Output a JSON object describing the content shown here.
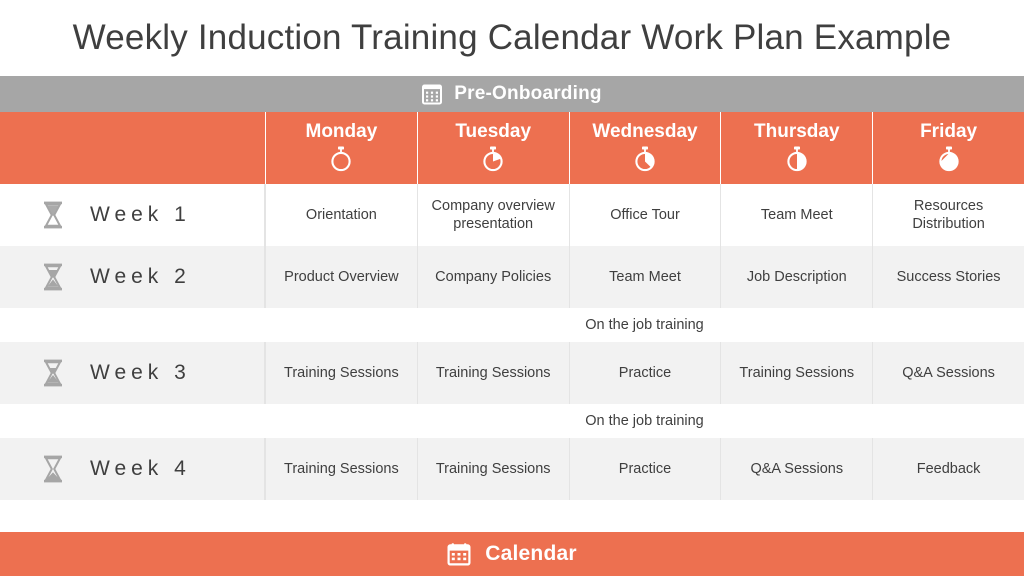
{
  "slide": {
    "title": "Weekly Induction Training Calendar Work Plan Example"
  },
  "banner": {
    "icon": "calendar-grid-icon",
    "label": "Pre-Onboarding",
    "background": "#A6A6A6",
    "text_color": "#FFFFFF"
  },
  "theme": {
    "accent": "#ED7050",
    "banner_gray": "#A6A6A6",
    "row_alt": "#F2F2F2",
    "row_plain": "#FFFFFF",
    "text": "#3F3F3F",
    "icon_gray": "#A6A6A6",
    "divider": "#E4E4E4"
  },
  "header": {
    "corner_label": "",
    "days": [
      {
        "label": "Monday",
        "icon": "stopwatch-icon",
        "fill": 0
      },
      {
        "label": "Tuesday",
        "icon": "stopwatch-icon",
        "fill": 25
      },
      {
        "label": "Wednesday",
        "icon": "stopwatch-icon",
        "fill": 35
      },
      {
        "label": "Thursday",
        "icon": "stopwatch-icon",
        "fill": 50
      },
      {
        "label": "Friday",
        "icon": "stopwatch-icon",
        "fill": 75
      }
    ]
  },
  "rows": [
    {
      "type": "week",
      "icon": "hourglass-icon",
      "label": "Week 1",
      "shade": "plain",
      "cells": [
        "Orientation",
        "Company overview presentation",
        "Office Tour",
        "Team Meet",
        "Resources Distribution"
      ]
    },
    {
      "type": "week",
      "icon": "hourglass-icon",
      "label": "Week 2",
      "shade": "alt",
      "cells": [
        "Product Overview",
        "Company Policies",
        "Team Meet",
        "Job Description",
        "Success Stories"
      ]
    },
    {
      "type": "divider",
      "label": "On the job training"
    },
    {
      "type": "week",
      "icon": "hourglass-icon",
      "label": "Week 3",
      "shade": "alt",
      "cells": [
        "Training Sessions",
        "Training Sessions",
        "Practice",
        "Training Sessions",
        "Q&A Sessions"
      ]
    },
    {
      "type": "divider",
      "label": "On the job training"
    },
    {
      "type": "week",
      "icon": "hourglass-icon",
      "label": "Week 4",
      "shade": "alt",
      "cells": [
        "Training Sessions",
        "Training Sessions",
        "Practice",
        "Q&A Sessions",
        "Feedback"
      ]
    }
  ],
  "footer": {
    "icon": "calendar-icon",
    "label": "Calendar",
    "background": "#ED7050",
    "text_color": "#FFFFFF"
  }
}
